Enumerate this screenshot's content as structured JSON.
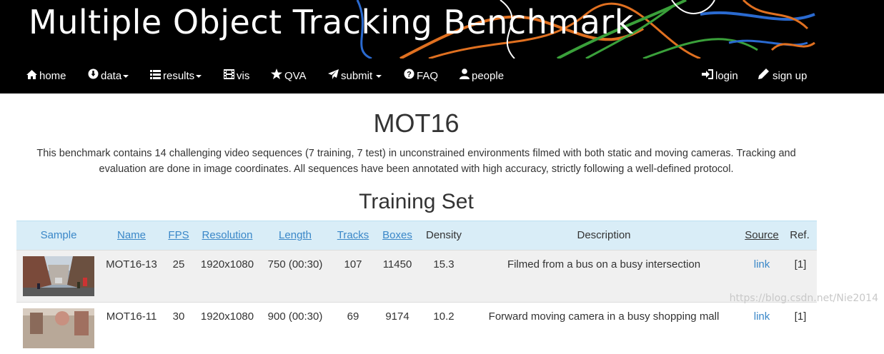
{
  "banner": {
    "title": "Multiple Object Tracking Benchmark"
  },
  "nav": {
    "left": [
      {
        "label": "home",
        "icon": "home-icon"
      },
      {
        "label": "data",
        "icon": "download-icon",
        "dropdown": true
      },
      {
        "label": "results",
        "icon": "list-icon",
        "dropdown": true
      },
      {
        "label": "vis",
        "icon": "film-icon"
      },
      {
        "label": "QVA",
        "icon": "star-icon"
      },
      {
        "label": "submit",
        "icon": "send-icon",
        "dropdown": true
      },
      {
        "label": "FAQ",
        "icon": "question-icon"
      },
      {
        "label": "people",
        "icon": "user-icon"
      }
    ],
    "right": [
      {
        "label": "login",
        "icon": "login-icon"
      },
      {
        "label": "sign up",
        "icon": "pencil-icon"
      }
    ]
  },
  "page": {
    "title": "MOT16",
    "intro": "This benchmark contains 14 challenging video sequences (7 training, 7 test) in unconstrained environments filmed with both static and moving cameras. Tracking and evaluation are done in image coordinates. All sequences have been annotated with high accuracy, strictly following a well-defined protocol.",
    "section_title": "Training Set"
  },
  "table": {
    "headers": {
      "sample": "Sample",
      "name": "Name",
      "fps": "FPS",
      "resolution": "Resolution",
      "length": "Length",
      "tracks": "Tracks",
      "boxes": "Boxes",
      "density": "Density",
      "description": "Description",
      "source": "Source",
      "ref": "Ref."
    },
    "rows": [
      {
        "name": "MOT16-13",
        "fps": "25",
        "resolution": "1920x1080",
        "length": "750 (00:30)",
        "tracks": "107",
        "boxes": "11450",
        "density": "15.3",
        "description": "Filmed from a bus on a busy intersection",
        "source": "link",
        "ref": "[1]"
      },
      {
        "name": "MOT16-11",
        "fps": "30",
        "resolution": "1920x1080",
        "length": "900 (00:30)",
        "tracks": "69",
        "boxes": "9174",
        "density": "10.2",
        "description": "Forward moving camera in a busy shopping mall",
        "source": "link",
        "ref": "[1]"
      }
    ]
  },
  "watermark": "https://blog.csdn.net/Nie2014",
  "colors": {
    "nav_bg": "#000000",
    "header_bg": "#d9edf7",
    "link": "#3a87c8",
    "row_alt": "#f0f0f0"
  }
}
